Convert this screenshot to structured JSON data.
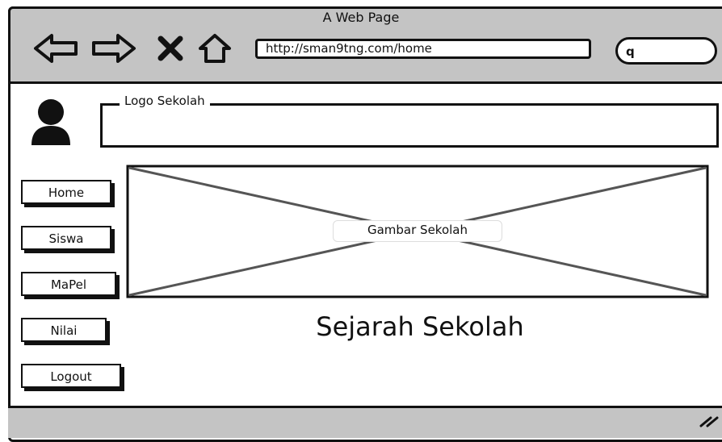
{
  "window": {
    "title": "A Web Page"
  },
  "toolbar": {
    "back_icon": "back-arrow-icon",
    "forward_icon": "forward-arrow-icon",
    "close_icon": "close-icon",
    "home_icon": "home-icon",
    "url": "http://sman9tng.com/home",
    "search_icon": "search-icon",
    "search_glyph": "q"
  },
  "header": {
    "avatar_icon": "user-avatar-icon",
    "logo_label": "Logo Sekolah"
  },
  "sidebar": {
    "items": [
      {
        "label": "Home"
      },
      {
        "label": "Siswa"
      },
      {
        "label": "MaPel"
      },
      {
        "label": "Nilai"
      },
      {
        "label": "Logout"
      }
    ]
  },
  "main": {
    "image_caption": "Gambar Sekolah",
    "heading": "Sejarah Sekolah"
  },
  "colors": {
    "chrome": "#c4c4c4",
    "ink": "#111111"
  }
}
